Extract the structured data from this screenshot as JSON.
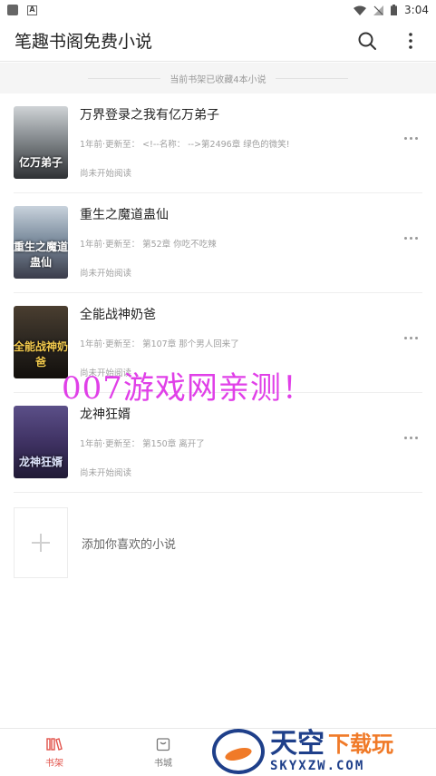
{
  "status_bar": {
    "time": "3:04"
  },
  "header": {
    "title": "笔趣书阁免费小说"
  },
  "shelf_info": "当前书架已收藏4本小说",
  "books": [
    {
      "title": "万界登录之我有亿万弟子",
      "update": "1年前·更新至： <!--名称： -->第2496章 绿色的微笑!",
      "status": "尚未开始阅读",
      "cover_text": "亿万弟子"
    },
    {
      "title": "重生之魔道蛊仙",
      "update": "1年前·更新至： 第52章 你吃不吃辣",
      "status": "尚未开始阅读",
      "cover_text": "重生之魔道蛊仙"
    },
    {
      "title": "全能战神奶爸",
      "update": "1年前·更新至： 第107章 那个男人回来了",
      "status": "尚未开始阅读",
      "cover_text": "全能战神奶爸"
    },
    {
      "title": "龙神狂婿",
      "update": "1年前·更新至： 第150章 离开了",
      "status": "尚未开始阅读",
      "cover_text": "龙神狂婿"
    }
  ],
  "add_book": {
    "label": "添加你喜欢的小说"
  },
  "watermark": "007游戏网亲测！",
  "bottom_nav": [
    {
      "label": "书架",
      "icon": "bookshelf-icon",
      "active": true
    },
    {
      "label": "书城",
      "icon": "store-icon",
      "active": false
    }
  ],
  "ad": {
    "brand_big": "天空",
    "brand_orange": "下载玩",
    "domain": "SKYXZW.COM"
  },
  "colors": {
    "accent": "#e2524a",
    "watermark": "#e040e8",
    "ad_blue": "#1e3f8a",
    "ad_orange": "#f07a28"
  }
}
